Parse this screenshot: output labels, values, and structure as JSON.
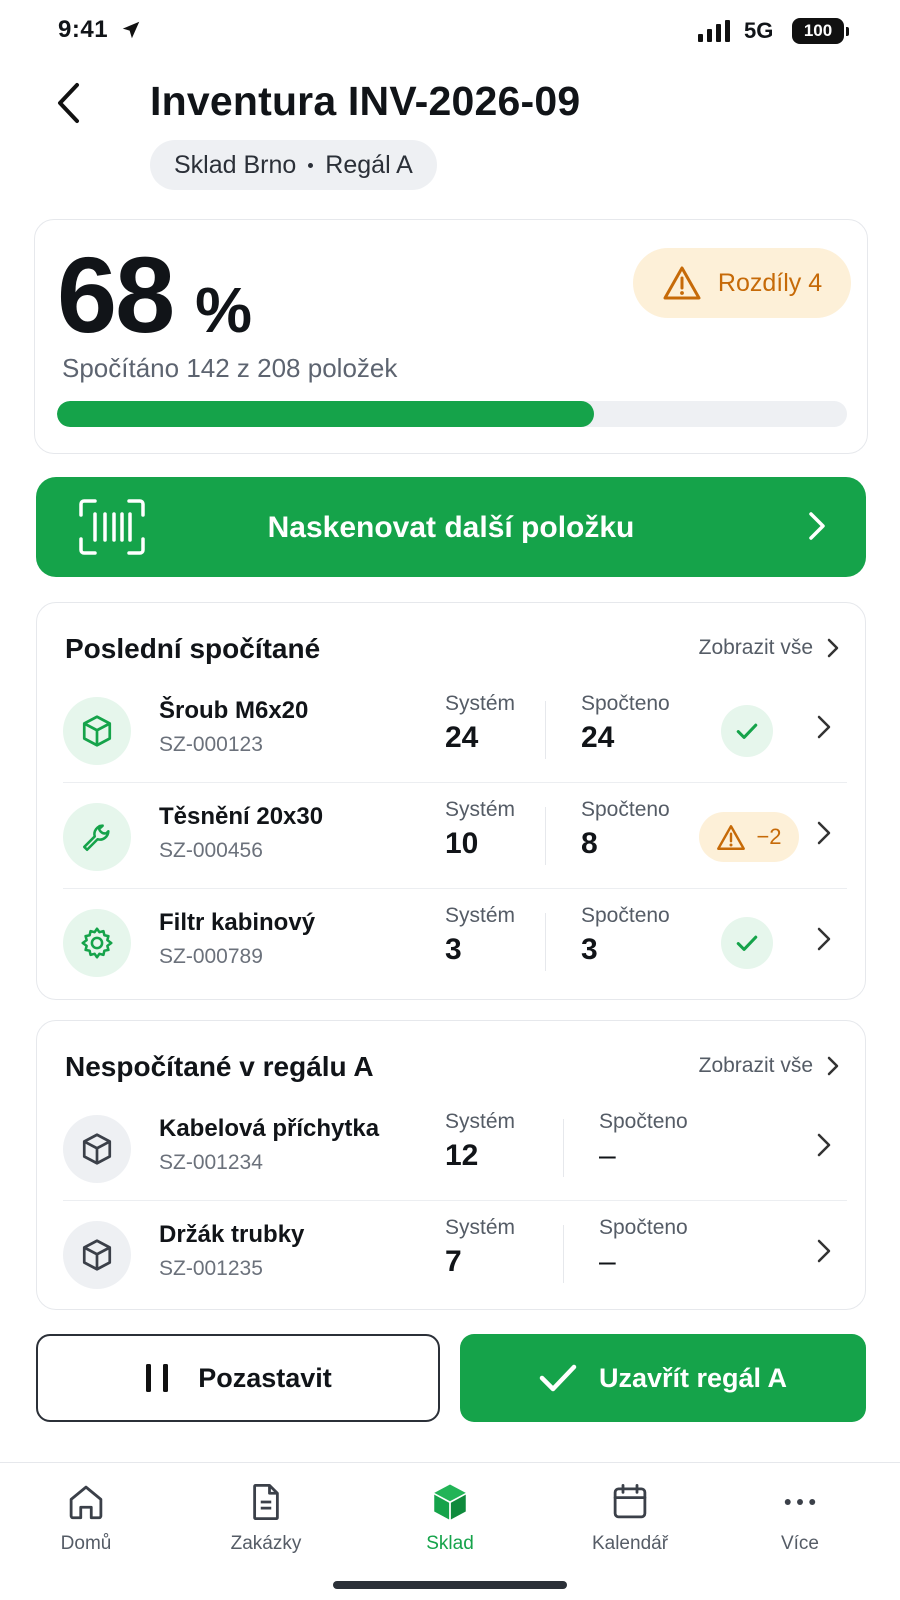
{
  "status_bar": {
    "time": "9:41",
    "network": "5G",
    "battery": "100"
  },
  "header": {
    "title": "Inventura INV-2026-09",
    "warehouse": "Sklad Brno",
    "location": "Regál A"
  },
  "progress": {
    "percent_value": "68",
    "percent_sign": "%",
    "counted_text": "Spočítáno 142 z 208 položek",
    "fraction": 0.68,
    "differences_label": "Rozdíly 4",
    "colors": {
      "accent": "#15a34a",
      "warning": "#c66a08",
      "warning_bg": "#fdf0d8"
    }
  },
  "scan_button": {
    "label": "Naskenovat další položku"
  },
  "recent": {
    "title": "Poslední spočítané",
    "view_all": "Zobrazit vše",
    "items": [
      {
        "name": "Šroub M6x20",
        "code": "SZ-000123",
        "system_label": "Systém",
        "system_value": "24",
        "counted_label": "Spočteno",
        "counted_value": "24",
        "status": "ok",
        "icon": "box-icon"
      },
      {
        "name": "Těsnění 20x30",
        "code": "SZ-000456",
        "system_label": "Systém",
        "system_value": "10",
        "counted_label": "Spočteno",
        "counted_value": "8",
        "status": "warning",
        "difference": "−2",
        "icon": "wrench-icon"
      },
      {
        "name": "Filtr kabinový",
        "code": "SZ-000789",
        "system_label": "Systém",
        "system_value": "3",
        "counted_label": "Spočteno",
        "counted_value": "3",
        "status": "ok",
        "icon": "gear-icon"
      }
    ]
  },
  "uncounted": {
    "title": "Nespočítané v regálu A",
    "view_all": "Zobrazit vše",
    "items": [
      {
        "name": "Kabelová příchytka",
        "code": "SZ-001234",
        "system_label": "Systém",
        "system_value": "12",
        "counted_label": "Spočteno",
        "counted_value": "–",
        "icon": "box-icon"
      },
      {
        "name": "Držák trubky",
        "code": "SZ-001235",
        "system_label": "Systém",
        "system_value": "7",
        "counted_label": "Spočteno",
        "counted_value": "–",
        "icon": "box-icon"
      }
    ]
  },
  "actions": {
    "pause": "Pozastavit",
    "close": "Uzavřít regál A"
  },
  "tab_bar": {
    "tabs": [
      {
        "label": "Domů",
        "icon": "home-icon"
      },
      {
        "label": "Zakázky",
        "icon": "document-icon"
      },
      {
        "label": "Sklad",
        "icon": "warehouse-box-icon",
        "active": true
      },
      {
        "label": "Kalendář",
        "icon": "calendar-icon"
      },
      {
        "label": "Více",
        "icon": "more-icon"
      }
    ]
  }
}
